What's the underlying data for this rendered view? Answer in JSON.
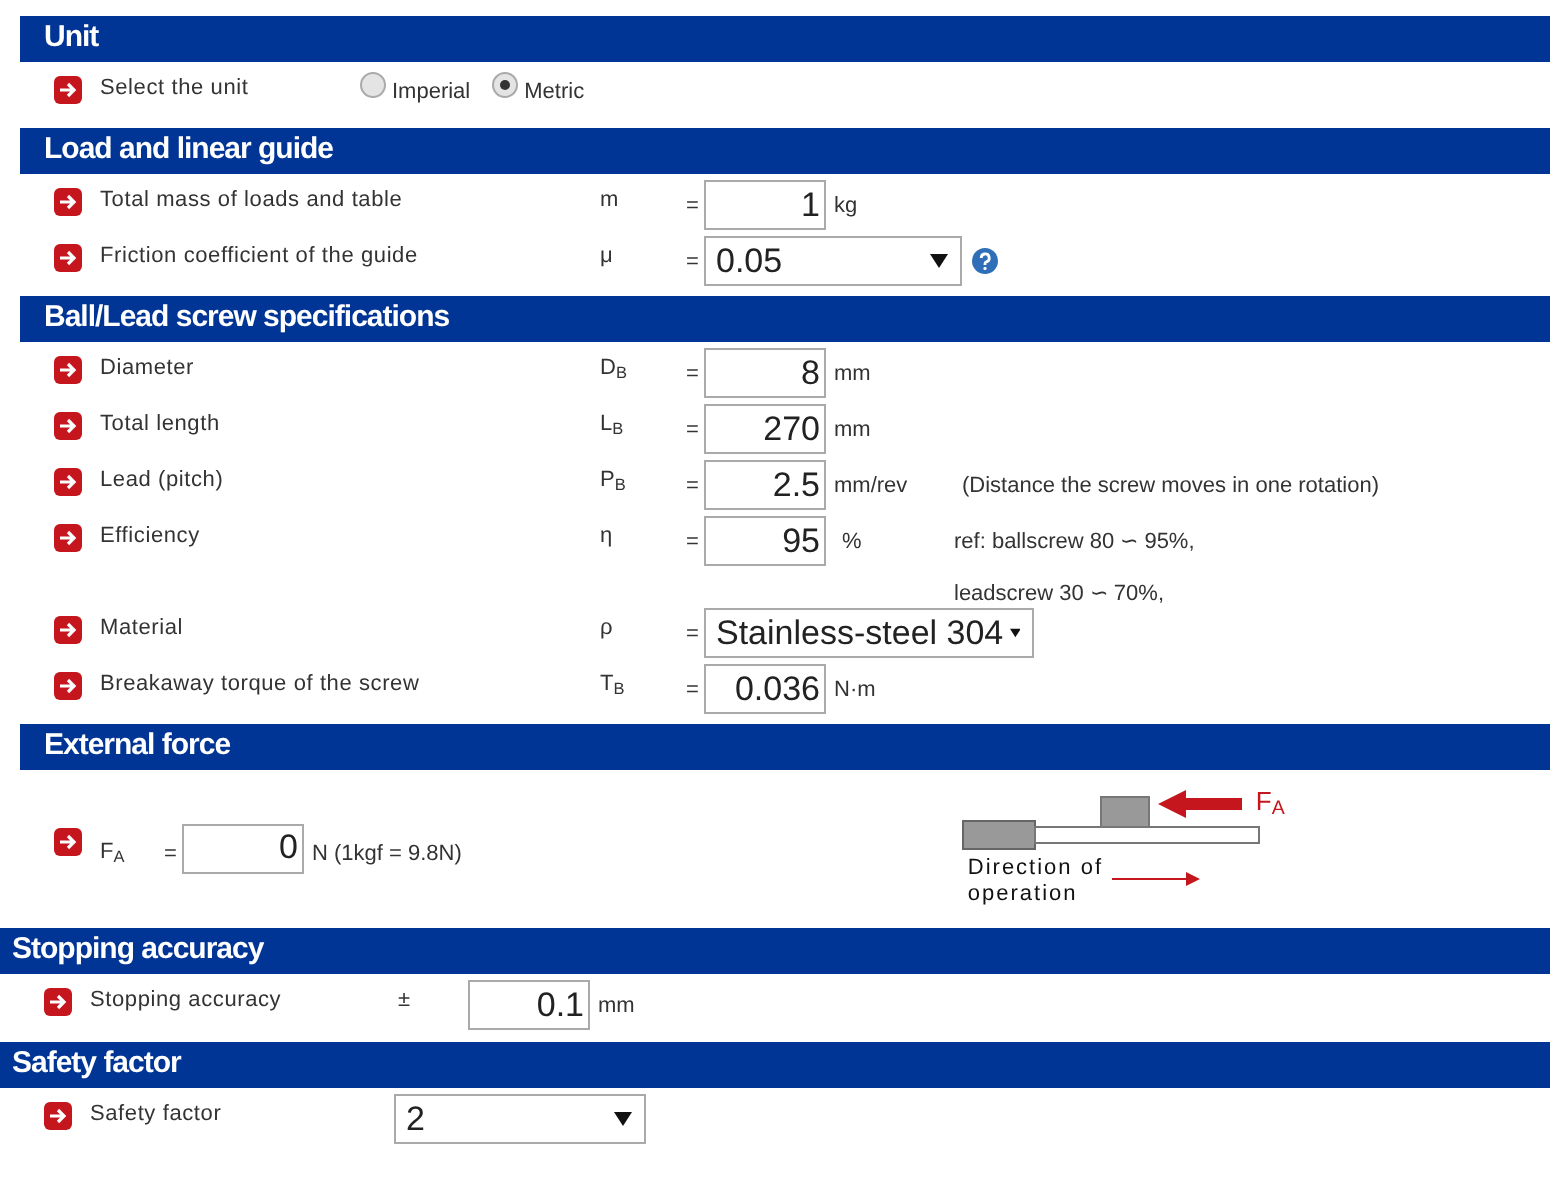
{
  "sections": [
    {
      "title": "Unit",
      "kind": "wide",
      "rows": [
        {
          "kind": "radio",
          "label": "Select the unit",
          "options": [
            {
              "label": "Imperial",
              "selected": false
            },
            {
              "label": "Metric",
              "selected": true
            }
          ]
        }
      ]
    },
    {
      "title": "Load and linear guide",
      "kind": "wide",
      "rows": [
        {
          "kind": "input",
          "label": "Total mass of loads and table",
          "symbol": "m",
          "relation": "=",
          "value": "1",
          "unit": "kg"
        },
        {
          "kind": "select",
          "label": "Friction coefficient of the guide",
          "symbol": "μ",
          "relation": "=",
          "value": "0.05",
          "help": true
        }
      ]
    },
    {
      "title": "Ball/Lead screw specifications",
      "kind": "wide",
      "rows": [
        {
          "kind": "input",
          "label": "Diameter",
          "symbol": "D$_{B}$",
          "relation": "=",
          "value": "8",
          "unit": "mm"
        },
        {
          "kind": "input",
          "label": "Total length",
          "symbol": "L$_{B}$",
          "relation": "=",
          "value": "270",
          "unit": "mm"
        },
        {
          "kind": "input",
          "label": "Lead (pitch)",
          "symbol": "P$_{B}$",
          "relation": "=",
          "value": "2.5",
          "unit": "mm/rev",
          "notes": [
            "(Distance the screw moves in one rotation)"
          ]
        },
        {
          "kind": "input",
          "label": "Efficiency",
          "symbol": "η",
          "relation": "=",
          "value": "95",
          "unit": "%",
          "notes": [
            "ref: ballscrew 80 ∽ 95%,",
            "leadscrew 30 ∽ 70%,"
          ]
        },
        {
          "kind": "material",
          "label": "Material",
          "symbol": "ρ",
          "relation": "=",
          "value": "Stainless-steel 304"
        },
        {
          "kind": "input",
          "label": "Breakaway torque of the screw",
          "symbol": "T$_{B}$",
          "relation": "=",
          "value": "0.036",
          "unit": "N·m"
        }
      ]
    },
    {
      "title": "External force",
      "kind": "force",
      "rows": [
        {
          "kind": "input",
          "symbol": "F$_{A}$",
          "relation": "=",
          "value": "0",
          "unit": "N (1kgf = 9.8N)",
          "diagram": {
            "force_label": "F$_{A}$",
            "direction_label": "Direction of operation"
          }
        }
      ]
    },
    {
      "title": "Stopping accuracy",
      "kind": "compact",
      "rows": [
        {
          "kind": "input",
          "label": "Stopping accuracy",
          "symbol": "±",
          "value": "0.1",
          "unit": "mm"
        }
      ]
    },
    {
      "title": "Safety factor",
      "kind": "compact",
      "rows": [
        {
          "kind": "select",
          "label": "Safety factor",
          "value": "2"
        }
      ]
    }
  ]
}
